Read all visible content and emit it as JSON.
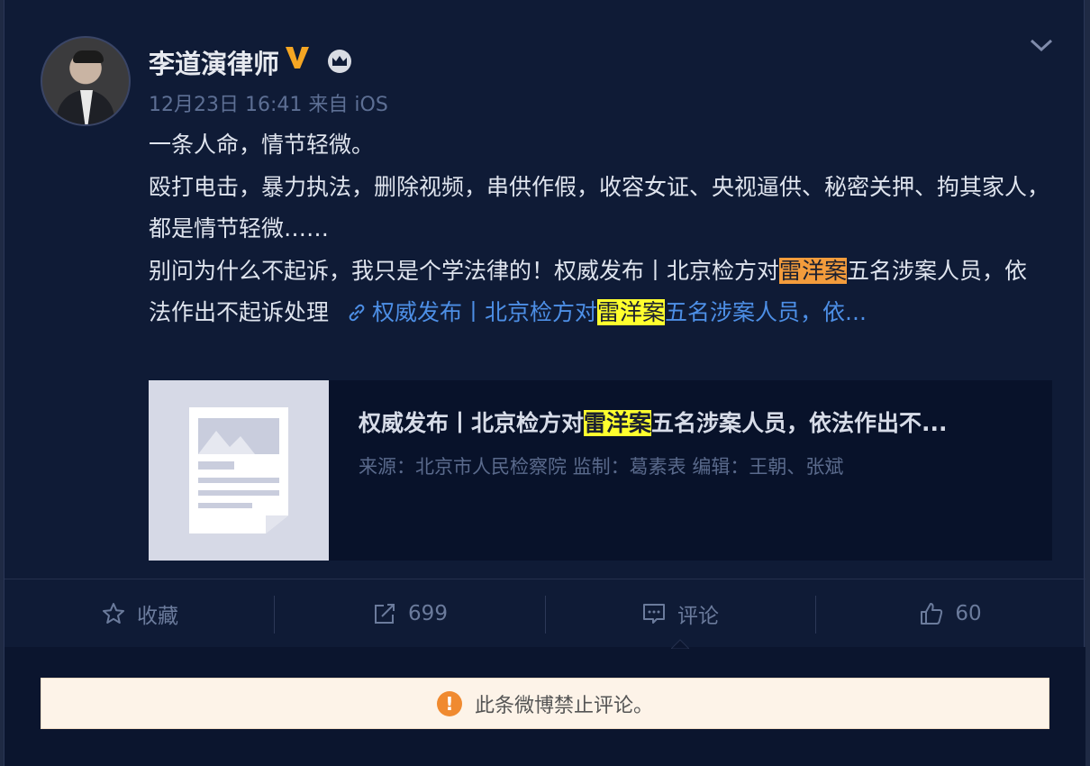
{
  "post": {
    "author": "李道演律师",
    "timestamp": "12月23日 16:41",
    "source": "来自 iOS",
    "lines": {
      "l1": "一条人命，情节轻微。",
      "l2": "殴打电击，暴力执法，删除视频，串供作假，收容女证、央视逼供、秘密关押、拘其家人，都是情节轻微……",
      "l3_pre": "别问为什么不起诉，我只是个学法律的！权威发布丨北京检方对",
      "l3_hl": "雷洋案",
      "l3_post": "五名涉案人员，依法作出不起诉处理"
    },
    "link": {
      "pre": "权威发布丨北京检方对",
      "hl": "雷洋案",
      "post": "五名涉案人员，依..."
    }
  },
  "preview": {
    "title_pre": "权威发布丨北京检方对",
    "title_hl": "雷洋案",
    "title_post": "五名涉案人员，依法作出不...",
    "subtitle": "来源：北京市人民检察院 监制：葛素表 编辑：王朝、张斌"
  },
  "actions": {
    "favorite": "收藏",
    "repost_count": "699",
    "comment": "评论",
    "like_count": "60"
  },
  "notice": {
    "text": "此条微博禁止评论。",
    "icon": "!"
  },
  "colors": {
    "background": "#0f1b36",
    "link": "#4d8fe6",
    "highlight_yellow": "#ffff2e",
    "highlight_orange": "#f39c3c",
    "verified": "#f5a623"
  }
}
